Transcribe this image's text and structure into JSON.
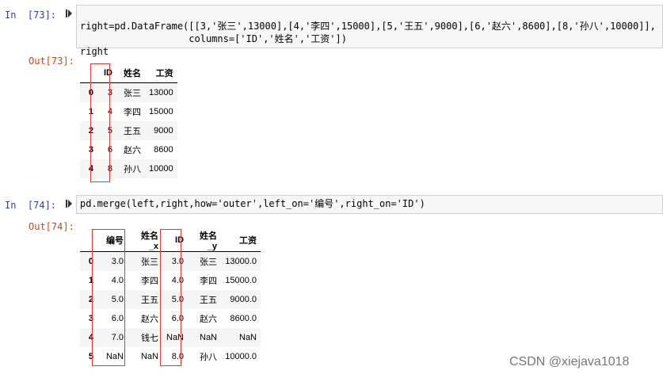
{
  "cell1": {
    "in_prompt": "In  [73]:",
    "code_lines": [
      [
        "right=pd.DataFrame([[3,'张三',13000],[4,'李四',15000],[5,'王五',9000],[6,'赵六',8600],[8,'孙八',10000]],"
      ],
      [
        "                   columns=['ID','姓名','工资'])"
      ],
      [
        "right"
      ]
    ],
    "out_prompt": "Out[73]:",
    "table": {
      "columns": [
        "ID",
        "姓名",
        "工资"
      ],
      "rows": [
        {
          "index": "0",
          "cells": [
            "3",
            "张三",
            "13000"
          ]
        },
        {
          "index": "1",
          "cells": [
            "4",
            "李四",
            "15000"
          ]
        },
        {
          "index": "2",
          "cells": [
            "5",
            "王五",
            "9000"
          ]
        },
        {
          "index": "3",
          "cells": [
            "6",
            "赵六",
            "8600"
          ]
        },
        {
          "index": "4",
          "cells": [
            "8",
            "孙八",
            "10000"
          ]
        }
      ]
    }
  },
  "cell2": {
    "in_prompt": "In  [74]:",
    "code": "pd.merge(left,right,how='outer',left_on='编号',right_on='ID')",
    "out_prompt": "Out[74]:",
    "table": {
      "columns": [
        "编号",
        "姓名_x",
        "ID",
        "姓名_y",
        "工资"
      ],
      "rows": [
        {
          "index": "0",
          "cells": [
            "3.0",
            "张三",
            "3.0",
            "张三",
            "13000.0"
          ]
        },
        {
          "index": "1",
          "cells": [
            "4.0",
            "李四",
            "4.0",
            "李四",
            "15000.0"
          ]
        },
        {
          "index": "2",
          "cells": [
            "5.0",
            "王五",
            "5.0",
            "王五",
            "9000.0"
          ]
        },
        {
          "index": "3",
          "cells": [
            "6.0",
            "赵六",
            "6.0",
            "赵六",
            "8600.0"
          ]
        },
        {
          "index": "4",
          "cells": [
            "7.0",
            "钱七",
            "NaN",
            "NaN",
            "NaN"
          ]
        },
        {
          "index": "5",
          "cells": [
            "NaN",
            "NaN",
            "8.0",
            "孙八",
            "10000.0"
          ]
        }
      ]
    }
  },
  "watermark": "CSDN @xiejava1018",
  "colors": {
    "in_prompt": "#303f9f",
    "out_prompt": "#d84315",
    "highlight_box": "#e53935",
    "code_bg": "#f7f7f7"
  }
}
